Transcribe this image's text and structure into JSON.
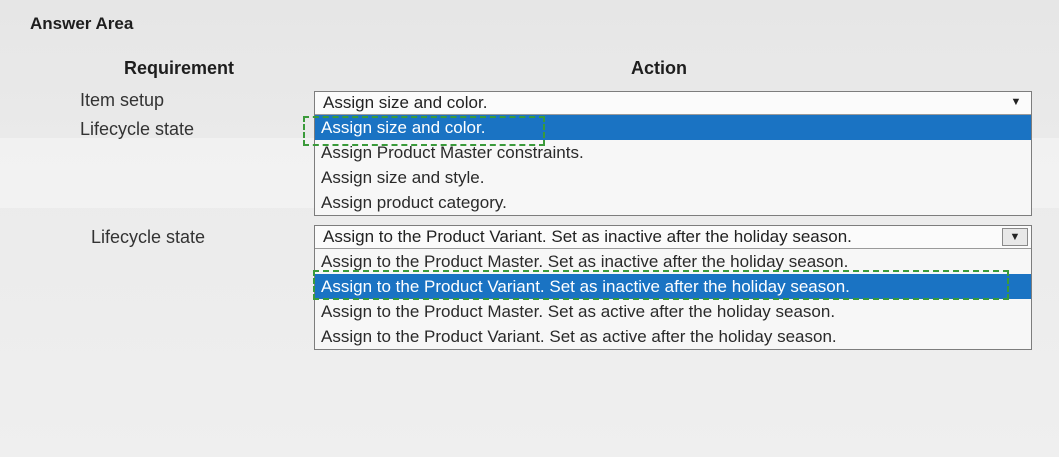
{
  "answer_area": {
    "title": "Answer Area"
  },
  "headers": {
    "requirement": "Requirement",
    "action": "Action"
  },
  "rows": [
    {
      "label": "Item setup"
    },
    {
      "label": "Lifecycle state"
    },
    {
      "label": "Lifecycle state"
    }
  ],
  "dropdown1": {
    "selected": "Assign size and color.",
    "options": [
      "Assign size and color.",
      "Assign Product Master constraints.",
      "Assign size and style.",
      "Assign product category."
    ],
    "highlighted_index": 0
  },
  "dropdown2": {
    "selected": "Assign to the Product Variant. Set as inactive after the holiday season.",
    "options": [
      "Assign to the Product Master. Set as inactive after the holiday season.",
      "Assign to the Product Variant. Set as inactive after the holiday season.",
      "Assign to the Product Master. Set as active after the holiday season.",
      "Assign to the Product Variant. Set as active after the holiday season."
    ],
    "highlighted_index": 1
  },
  "icons": {
    "dropdown_arrow": "chevron-down-icon"
  },
  "colors": {
    "selection": "#1a73c3",
    "answer_marker": "#3a9a3a"
  }
}
